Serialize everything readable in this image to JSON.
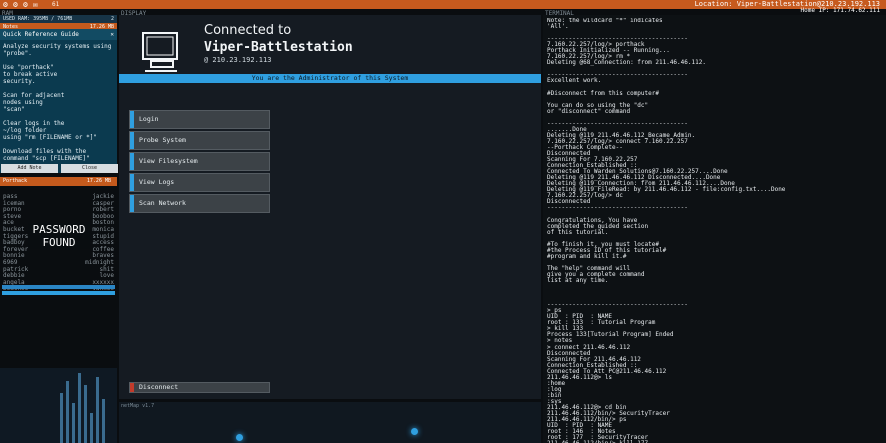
{
  "topbar": {
    "number": "61",
    "location": "Location: Viper-Battlestation@210.23.192.113",
    "home": "Home IP: 171.74.62.111"
  },
  "labels": {
    "ram": "RAM",
    "display": "DISPLAY",
    "terminal": "TERMINAL",
    "netmap": "netMap v1.7"
  },
  "ram": {
    "used": "USED RAM: 395MB / 761MB",
    "count": "2",
    "notes": "Notes",
    "notes_mb": "17.26 MB"
  },
  "guide": {
    "title": "Quick Reference Guide",
    "close_glyph": "✕",
    "text": "Analyze security systems using \"probe\".\n\nUse \"porthack\"\nto break active\nsecurity.\n\nScan for adjacent\nnodes using\n\"scan\"\n\nClear logs in the\n~/log folder\nusing \"rm [FILENAME or *]\"\n\nDownload files with the\ncommand \"scp [FILENAME]\"",
    "add_note": "Add Note",
    "close": "Close"
  },
  "cracker": {
    "name": "Porthack",
    "mem": "17.26 MB"
  },
  "passwords": {
    "left": "pass\niceman\nporno\nsteve\nace\nbucket\ntiggers\nbadboy\nforever\nbonnie\n6969\npatrick\ndebbie\nangela\npeaches\njordan\nandrea",
    "right": "jackie\ncasper\nrobert\nbooboo\nboston\nmonica\nstupid\naccess\ncoffee\nbraves\nmidnight\nshit\nlove\nxxxxxx\nyankee\ncollege\nsaturn",
    "found_label": "PASSWORD\nFOUND"
  },
  "display": {
    "connected": "Connected to",
    "host": "Viper-Battlestation",
    "ip": "@ 210.23.192.113",
    "admin_banner": "You are the Administrator of this System",
    "menu": [
      "Login",
      "Probe System",
      "View Filesystem",
      "View Logs",
      "Scan Network"
    ],
    "disconnect": "Disconnect"
  },
  "terminal": {
    "text": "Note: the wildcard \"*\" indicates\n'All'.\n\n---------------------------------------\n7.160.22.257/log/> porthack\nPorthack Initialized -- Running...\n7.160.22.257/log/> rm *\nDeleting @68_Connection: from 211.46.46.112.\n\n---------------------------------------\nExcellent work.\n\n#Disconnect from this computer#\n\nYou can do so using the \"dc\"\nor \"disconnect\" command\n\n---------------------------------------\n.......Done\nDeleting @119_211.46.46.112_Became_Admin.\n7.160.22.257/log/> connect 7.160.22.257\n--Porthack Complete--\nDisconnected\nScanning For 7.160.22.257\nConnection Established ::\nConnected To Warden Solutions@7.160.22.257....Done\nDeleting @119_211.46.46.112_Disconnected....Done\nDeleting @119_Connection: from 211.46.46.112....Done\nDeleting @119_FileRead: by 211.46.46.112 - file:config.txt....Done\n7.160.22.257/log/> dc\nDisconnected\n---------------------------------------\n\nCongratulations, You have\ncompleted the guided section\nof this tutorial.\n\n#To finish it, you must locate#\n#the Process ID of this tutorial#\n#program and kill it.#\n\nThe \"help\" command will\ngive you a complete command\nlist at any time.\n\n\n\n---------------------------------------\n> ps\nUID  : PID  : NAME\nroot : 133  : Tutorial Program\n> kill 133\nProcess 133[Tutorial Program] Ended\n> notes\n> connect 211.46.46.112\nDisconnected\nScanning For 211.46.46.112\nConnection Established ::\nConnected To Att PC@211.46.46.112\n211.46.46.112@> ls\n:home\n:log\n:bin\n:sys\n211.46.46.112@> cd bin\n211.46.46.112/bin/> SecurityTracer\n211.46.46.112/bin/> ps\nUID  : PID  : NAME\nroot : 146  : Notes\nroot : 177  : SecurityTracer\n211.46.46.112/bin/> kill 177\nProcess 177[Security Tracer] Ended\n211.46.46.112/bin/> rm SecurityTracer.exe\nDeleting SecurityTracer.exe....Done\n211.46.46.112/bin/> dc\nDisconnected\nScanning For 210.23.192.113\nConnection Established ::\nConnected To Viper-Battlestation@210.23.192.113\n210.23.192.113@> PortHack"
  }
}
